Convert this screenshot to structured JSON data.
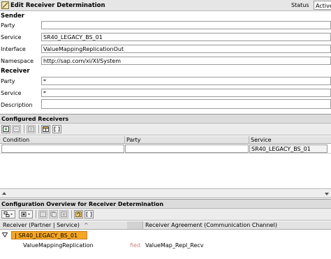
{
  "window": {
    "title": "Edit Receiver Determination",
    "status_label": "Status",
    "status_value": "Active"
  },
  "sender": {
    "heading": "Sender",
    "party_label": "Party",
    "party_value": "",
    "service_label": "Service",
    "service_value": "SR40_LEGACY_BS_01",
    "interface_label": "Interface",
    "interface_value": "ValueMappingReplicationOut",
    "namespace_label": "Namespace",
    "namespace_value": "http://sap.com/xi/XI/System"
  },
  "receiver": {
    "heading": "Receiver",
    "party_label": "Party",
    "party_value": "*",
    "service_label": "Service",
    "service_value": "*",
    "description_label": "Description",
    "description_value": ""
  },
  "configured_receivers": {
    "heading": "Configured Receivers",
    "columns": [
      "Condition",
      "Party",
      "Service"
    ],
    "rows": [
      {
        "condition": "",
        "party": "",
        "service": "SR40_LEGACY_BS_01"
      }
    ]
  },
  "configuration_overview": {
    "heading": "Configuration Overview for Receiver Determination",
    "col_receiver": "Receiver (Partner | Service)",
    "sort_marker": "^",
    "col_agreement": "Receiver Agreement (Communication Channel)",
    "tree_root": "| SR40_LEGACY_BS_01",
    "child_interface": "ValueMappingReplication",
    "child_status": "fied",
    "child_agreement": "ValueMap_Repl_Recv"
  }
}
